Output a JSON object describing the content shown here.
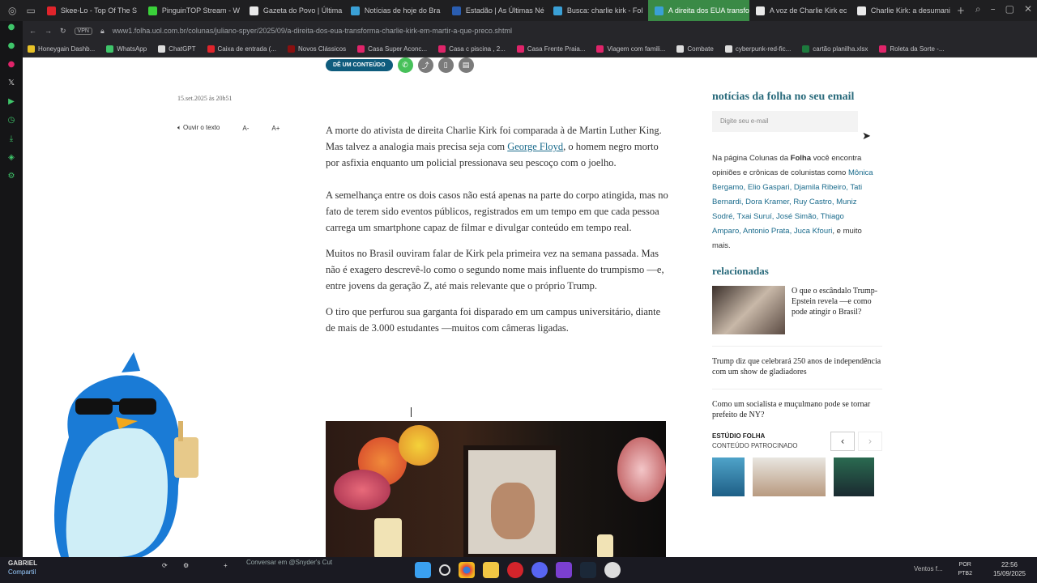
{
  "browser": {
    "tabs": [
      {
        "label": "Skee-Lo - Top Of The S",
        "color": "#e0242b"
      },
      {
        "label": "PinguinTOP Stream - W",
        "color": "#3ad13a"
      },
      {
        "label": "Gazeta do Povo | Última",
        "color": "#e9e9e9"
      },
      {
        "label": "Notícias de hoje do Bra",
        "color": "#3aa0d6"
      },
      {
        "label": "Estadão | As Últimas Né",
        "color": "#2a5db0"
      },
      {
        "label": "Busca: charlie kirk - Fol",
        "color": "#3aa0d6"
      },
      {
        "label": "A direita dos EUA transfo",
        "color": "#3aa0d6",
        "active": true
      },
      {
        "label": "A voz de Charlie Kirk ec",
        "color": "#e9e9e9"
      },
      {
        "label": "Charlie Kirk: a desumani",
        "color": "#e9e9e9"
      }
    ],
    "new_tab": "+",
    "vpn": "VPN",
    "url": "www1.folha.uol.com.br/colunas/juliano-spyer/2025/09/a-direita-dos-eua-transforma-charlie-kirk-em-martir-a-que-preco.shtml",
    "bookmarks": [
      {
        "label": "Honeygain Dashb...",
        "color": "#e8c227"
      },
      {
        "label": "WhatsApp",
        "color": "#3fc56a"
      },
      {
        "label": "ChatGPT",
        "color": "#dddddd"
      },
      {
        "label": "Caixa de entrada (...",
        "color": "#e0242b"
      },
      {
        "label": "Novos Clássicos",
        "color": "#8a1010"
      },
      {
        "label": "Casa Super Aconc...",
        "color": "#e0246a"
      },
      {
        "label": "Casa c piscina , 2...",
        "color": "#e0246a"
      },
      {
        "label": "Casa Frente Praia...",
        "color": "#e0246a"
      },
      {
        "label": "Viagem com famili...",
        "color": "#e0246a"
      },
      {
        "label": "Combate",
        "color": "#dddddd"
      },
      {
        "label": "cyberpunk-red-fic...",
        "color": "#dddddd"
      },
      {
        "label": "cartão planilha.xlsx",
        "color": "#1d7a3d"
      },
      {
        "label": "Roleta da Sorte -...",
        "color": "#e0246a"
      }
    ]
  },
  "article": {
    "share_button": "DÊ UM CONTEÚDO",
    "date": "15.set.2025 às 20h51",
    "tools": {
      "listen": "Ouvir o texto",
      "font_minus": "A-",
      "font_plus": "A+"
    },
    "p1_pre": "A morte do ativista de direita Charlie Kirk foi comparada à de Martin Luther King. Mas talvez a analogia mais precisa seja com ",
    "p1_link": "George Floyd",
    "p1_post": ", o homem negro morto por asfixia enquanto um policial pressionava seu pescoço com o joelho.",
    "p2": "A semelhança entre os dois casos não está apenas na parte do corpo atingida, mas no fato de terem sido eventos públicos, registrados em um tempo em que cada pessoa carrega um smartphone capaz de filmar e divulgar conteúdo em tempo real.",
    "p3": "Muitos no Brasil ouviram falar de Kirk pela primeira vez na semana passada. Mas não é exagero descrevê-lo como o segundo nome mais influente do trumpismo —e, entre jovens da geração Z, até mais relevante que o próprio Trump.",
    "p4": "O tiro que perfurou sua garganta foi disparado em um campus universitário, diante de mais de 3.000 estudantes —muitos com câmeras ligadas."
  },
  "sidebar_right": {
    "newsletter_title": "notícias da folha no seu email",
    "email_placeholder": "Digite seu e-mail",
    "desc_pre": "Na página Colunas da ",
    "desc_brand": "Folha",
    "desc_mid": " você encontra opiniões e crônicas de colunistas como ",
    "desc_names": "Mônica Bergamo, Elio Gaspari, Djamila Ribeiro, Tati Bernardi, Dora Kramer, Ruy Castro, Muniz Sodré, Txai Suruí, José Simão, Thiago Amparo, Antonio Prata, Juca Kfouri",
    "desc_end": ", e muito mais.",
    "related_title": "relacionadas",
    "related": [
      "O que o escândalo Trump-Epstein revela —e como pode atingir o Brasil?",
      "Trump diz que celebrará 250 anos de independência com um show de gladiadores",
      "Como um socialista e muçulmano pode se tornar prefeito de NY?"
    ],
    "studio_label": "ESTÚDIO FOLHA",
    "studio_sub": "CONTEÚDO PATROCINADO",
    "prev": "‹",
    "next": "›"
  },
  "taskbar": {
    "user": "GABRIEL",
    "sub": "Compartil",
    "chat": "Conversar em @Snyder's Cut",
    "lang1": "POR",
    "lang2": "PTB2",
    "time": "22:56",
    "date": "15/09/2025",
    "weather": "Ventos f..."
  }
}
